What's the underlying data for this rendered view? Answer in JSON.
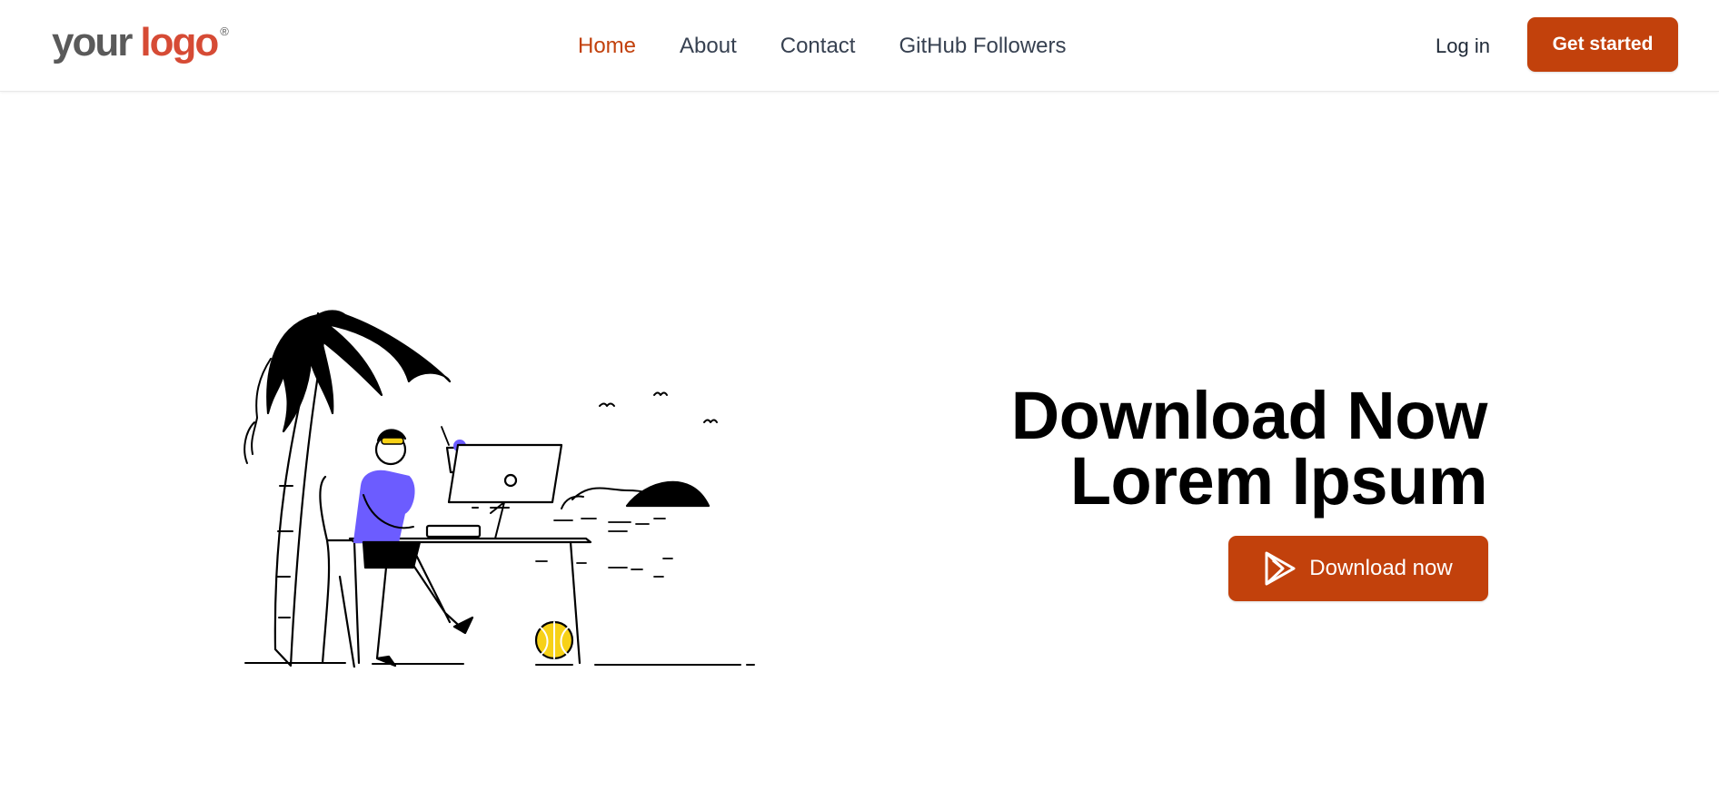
{
  "header": {
    "logo": {
      "part1": "your",
      "part2": "logo",
      "mark": "®"
    },
    "nav": [
      {
        "label": "Home",
        "active": true
      },
      {
        "label": "About",
        "active": false
      },
      {
        "label": "Contact",
        "active": false
      },
      {
        "label": "GitHub Followers",
        "active": false
      }
    ],
    "login_label": "Log in",
    "cta_label": "Get started"
  },
  "hero": {
    "title_line1": "Download Now",
    "title_line2": "Lorem Ipsum",
    "button_label": "Download now",
    "button_icon": "play-store-icon",
    "illustration": "person-working-at-desk-under-palm-tree"
  },
  "colors": {
    "accent": "#c2410c",
    "logo_red": "#d64b35",
    "logo_gray": "#5a5a5a",
    "illustration_purple": "#6c5cff",
    "illustration_yellow": "#f7d117"
  }
}
